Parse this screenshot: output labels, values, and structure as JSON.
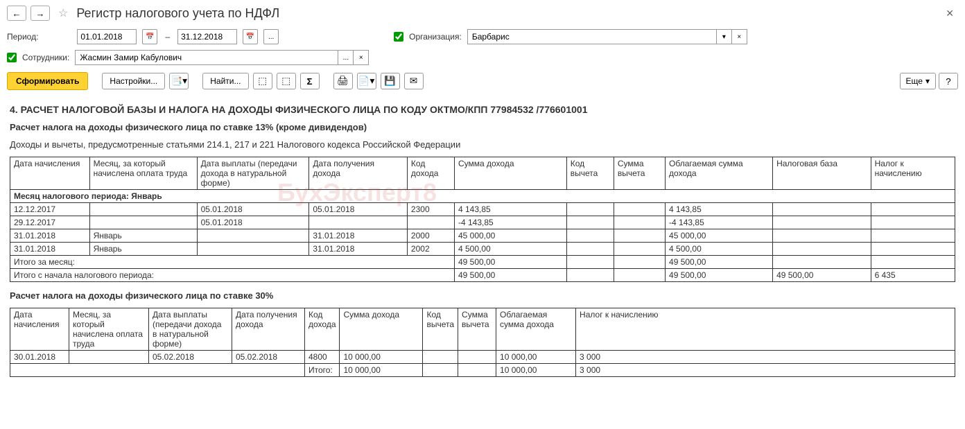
{
  "header": {
    "title": "Регистр налогового учета по НДФЛ"
  },
  "filters": {
    "period_label": "Период:",
    "date_from": "01.01.2018",
    "date_to": "31.12.2018",
    "org_label": "Организация:",
    "org_value": "Барбарис",
    "emp_label": "Сотрудники:",
    "emp_value": "Жасмин Замир Кабулович"
  },
  "toolbar": {
    "generate": "Сформировать",
    "settings": "Настройки...",
    "find": "Найти...",
    "more": "Еще"
  },
  "report": {
    "section4_title": "4. РАСЧЕТ НАЛОГОВОЙ БАЗЫ И НАЛОГА НА ДОХОДЫ ФИЗИЧЕСКОГО ЛИЦА ПО КОДУ ОКТМО/КПП 77984532   /776601001",
    "rate13_title": "Расчет налога на доходы физического лица по ставке 13% (кроме дивидендов)",
    "articles_text": "Доходы и вычеты, предусмотренные статьями 214.1, 217 и 221 Налогового кодекса Российской Федерации",
    "rate30_title": "Расчет налога на доходы физического лица по ставке 30%",
    "headers": {
      "c1": "Дата начисления",
      "c2": "Месяц, за который начислена оплата труда",
      "c3": "Дата выплаты (передачи дохода в натуральной форме)",
      "c4": "Дата получения дохода",
      "c5": "Код дохода",
      "c6": "Сумма дохода",
      "c7": "Код вычета",
      "c8": "Сумма вычета",
      "c9": "Облагаемая сумма дохода",
      "c10": "Налоговая база",
      "c11": "Налог к начислению"
    },
    "month_row": "Месяц налогового периода: Январь",
    "rows13": [
      {
        "c1": "12.12.2017",
        "c2": "",
        "c3": "05.01.2018",
        "c4": "05.01.2018",
        "c5": "2300",
        "c6": "4 143,85",
        "c7": "",
        "c8": "",
        "c9": "4 143,85",
        "c10": "",
        "c11": ""
      },
      {
        "c1": "29.12.2017",
        "c2": "",
        "c3": "05.01.2018",
        "c4": "",
        "c5": "",
        "c6": "-4 143,85",
        "c7": "",
        "c8": "",
        "c9": "-4 143,85",
        "c10": "",
        "c11": ""
      },
      {
        "c1": "31.01.2018",
        "c2": "Январь",
        "c3": "",
        "c4": "31.01.2018",
        "c5": "2000",
        "c6": "45 000,00",
        "c7": "",
        "c8": "",
        "c9": "45 000,00",
        "c10": "",
        "c11": ""
      },
      {
        "c1": "31.01.2018",
        "c2": "Январь",
        "c3": "",
        "c4": "31.01.2018",
        "c5": "2002",
        "c6": "4 500,00",
        "c7": "",
        "c8": "",
        "c9": "4 500,00",
        "c10": "",
        "c11": ""
      }
    ],
    "total_month_label": "Итого за месяц:",
    "total_month_c6": "49 500,00",
    "total_month_c9": "49 500,00",
    "total_period_label": "Итого с начала налогового периода:",
    "total_period_c6": "49 500,00",
    "total_period_c9": "49 500,00",
    "total_period_c10": "49 500,00",
    "total_period_c11": "6 435",
    "rows30": [
      {
        "c1": "30.01.2018",
        "c2": "",
        "c3": "05.02.2018",
        "c4": "05.02.2018",
        "c5": "4800",
        "c6": "10 000,00",
        "c7": "",
        "c8": "",
        "c9": "10 000,00",
        "c10": "",
        "c11": "3 000"
      }
    ],
    "total30_label": "Итого:",
    "total30_c6": "10 000,00",
    "total30_c9": "10 000,00",
    "total30_c11": "3 000"
  },
  "watermark": {
    "main": "БухЭксперт8"
  }
}
